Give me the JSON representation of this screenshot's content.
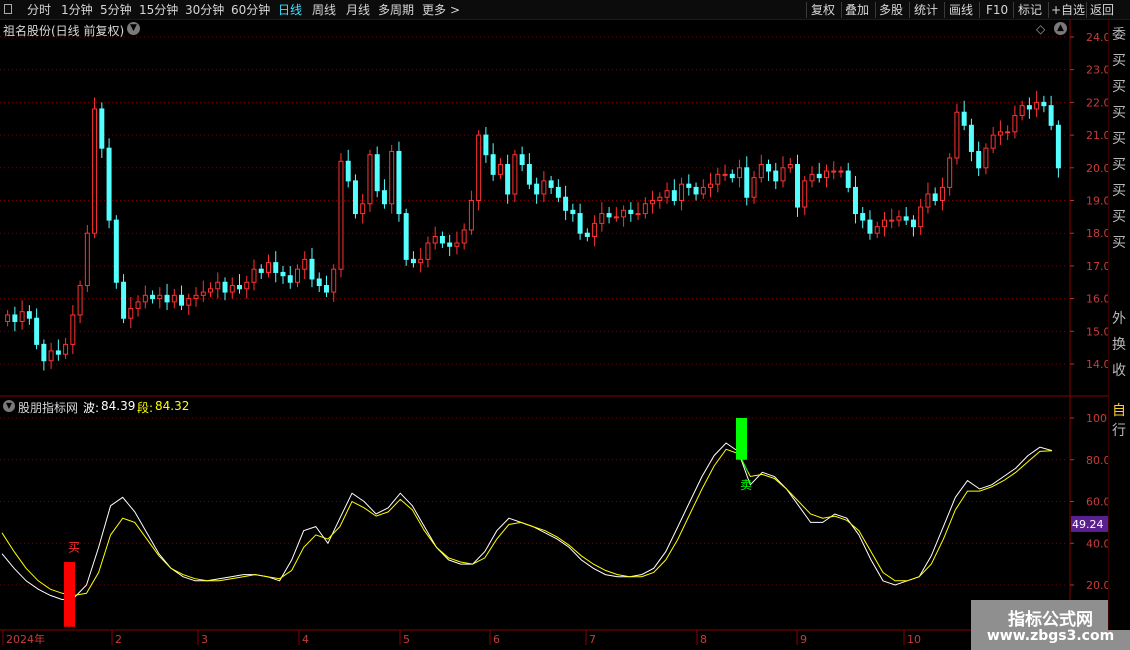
{
  "toolbar": {
    "periods": [
      "分时",
      "1分钟",
      "5分钟",
      "15分钟",
      "30分钟",
      "60分钟",
      "日线",
      "周线",
      "月线",
      "多周期",
      "更多"
    ],
    "active_period": "日线",
    "more_arrow": ">",
    "right_buttons": [
      "复权",
      "叠加",
      "多股",
      "统计",
      "画线",
      "F10",
      "标记",
      "+自选",
      "返回"
    ]
  },
  "main_chart": {
    "title": "祖名股份(日线 前复权)",
    "y_ticks": [
      "24.00",
      "23.00",
      "22.00",
      "21.00",
      "20.00",
      "19.00",
      "18.00",
      "17.00",
      "16.00",
      "15.00",
      "14.00"
    ],
    "diamond_symbol": "◇"
  },
  "indicator": {
    "name": "股朋指标网",
    "wave_label": "波:",
    "wave_value": "84.39",
    "segment_label": "段:",
    "segment_value": "84.32",
    "y_ticks": [
      "100.0",
      "80.00",
      "60.00",
      "40.00",
      "20.00"
    ],
    "current_value": "49.24",
    "buy_label": "买",
    "sell_label": "卖"
  },
  "x_axis": {
    "labels": [
      "2024年",
      "2",
      "3",
      "4",
      "5",
      "6",
      "7",
      "8",
      "9",
      "10"
    ]
  },
  "watermark": {
    "line1": "指标公式网",
    "line2": "www.zbgs3.com"
  },
  "sidebar": {
    "chars": [
      "委",
      "买",
      "买",
      "买",
      "买",
      "买",
      "买",
      "买",
      "买",
      "外",
      "换",
      "收",
      "自",
      "行"
    ]
  },
  "colors": {
    "up": "#ff3232",
    "down": "#54ffff",
    "wave": "#ffffff",
    "segment": "#ffff00",
    "grid": "#7a0000",
    "buy_bar": "#ff0000",
    "sell_bar": "#00ff00",
    "highlight": "#5a2090"
  },
  "chart_data": [
    {
      "type": "candlestick",
      "title": "祖名股份(日线 前复权)",
      "ylim": [
        13.5,
        24.3
      ],
      "x": [
        "2024年",
        "2",
        "3",
        "4",
        "5",
        "6",
        "7",
        "8",
        "9",
        "10"
      ],
      "close": [
        15.5,
        15.3,
        15.6,
        15.4,
        14.6,
        14.1,
        14.4,
        14.3,
        14.6,
        15.5,
        16.4,
        18.0,
        21.8,
        20.6,
        18.4,
        16.5,
        15.4,
        15.7,
        15.9,
        16.1,
        16.0,
        16.1,
        15.9,
        16.1,
        15.8,
        16.0,
        16.1,
        16.2,
        16.3,
        16.5,
        16.2,
        16.4,
        16.3,
        16.5,
        16.9,
        16.8,
        17.1,
        16.8,
        16.7,
        16.5,
        16.9,
        17.2,
        16.6,
        16.4,
        16.2,
        16.9,
        20.2,
        19.6,
        18.6,
        18.9,
        20.4,
        19.3,
        18.9,
        20.5,
        18.6,
        17.2,
        17.1,
        17.2,
        17.7,
        17.9,
        17.7,
        17.6,
        17.7,
        18.1,
        19.0,
        21.0,
        20.4,
        19.8,
        20.1,
        19.2,
        20.4,
        20.1,
        19.5,
        19.2,
        19.6,
        19.4,
        19.1,
        18.7,
        18.6,
        18.0,
        17.9,
        18.3,
        18.6,
        18.5,
        18.5,
        18.7,
        18.6,
        18.6,
        18.9,
        19.0,
        19.1,
        19.3,
        19.0,
        19.5,
        19.4,
        19.2,
        19.4,
        19.5,
        19.8,
        19.8,
        19.7,
        20.0,
        19.1,
        19.7,
        20.1,
        19.9,
        19.6,
        20.0,
        20.1,
        18.8,
        19.6,
        19.8,
        19.7,
        19.9,
        19.9,
        19.9,
        19.4,
        18.6,
        18.4,
        18.0,
        18.2,
        18.4,
        18.4,
        18.5,
        18.4,
        18.2,
        18.8,
        19.2,
        19.0,
        19.4,
        20.3,
        21.7,
        21.3,
        20.5,
        20.0,
        20.6,
        21.0,
        21.1,
        21.1,
        21.6,
        21.9,
        21.8,
        22.0,
        21.9,
        21.3,
        20.0
      ]
    },
    {
      "type": "line",
      "title": "股朋指标网",
      "ylim": [
        0,
        105
      ],
      "series": [
        {
          "name": "波",
          "values": [
            35,
            28,
            22,
            18,
            15,
            13,
            14,
            20,
            38,
            58,
            62,
            55,
            45,
            35,
            28,
            24,
            22,
            22,
            23,
            24,
            25,
            25,
            24,
            22,
            32,
            46,
            48,
            40,
            52,
            64,
            60,
            54,
            57,
            64,
            58,
            48,
            38,
            32,
            30,
            30,
            36,
            46,
            52,
            50,
            48,
            45,
            42,
            38,
            32,
            28,
            25,
            24,
            24,
            25,
            28,
            36,
            48,
            60,
            72,
            82,
            88,
            84,
            68,
            74,
            72,
            66,
            58,
            50,
            50,
            54,
            52,
            44,
            32,
            22,
            20,
            22,
            24,
            34,
            48,
            62,
            70,
            66,
            68,
            72,
            76,
            82,
            86,
            84.39
          ]
        },
        {
          "name": "段",
          "values": [
            45,
            36,
            28,
            22,
            18,
            16,
            15,
            16,
            26,
            44,
            52,
            50,
            42,
            34,
            28,
            25,
            23,
            22,
            22,
            23,
            24,
            25,
            24,
            23,
            27,
            38,
            44,
            42,
            48,
            60,
            57,
            53,
            55,
            61,
            56,
            46,
            38,
            33,
            31,
            30,
            33,
            42,
            49,
            50,
            48,
            46,
            43,
            39,
            34,
            30,
            27,
            25,
            24,
            24,
            26,
            32,
            42,
            54,
            66,
            77,
            85,
            83,
            72,
            73,
            71,
            66,
            60,
            54,
            52,
            53,
            51,
            46,
            36,
            26,
            22,
            22,
            24,
            30,
            42,
            56,
            65,
            65,
            67,
            70,
            74,
            79,
            84,
            84.32
          ]
        }
      ]
    }
  ]
}
